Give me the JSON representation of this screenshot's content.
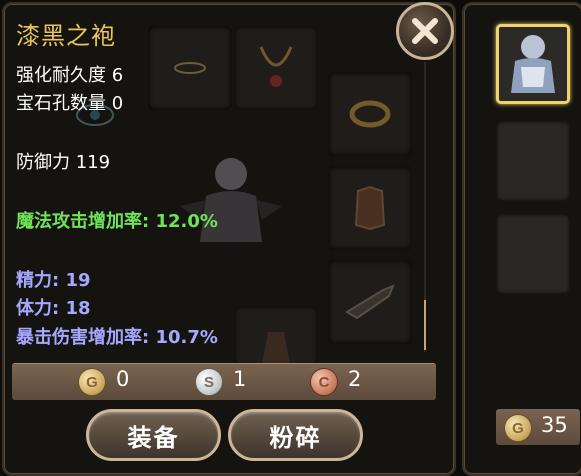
{
  "item": {
    "name": "漆黑之袍",
    "stats": [
      {
        "text": "强化耐久度 6",
        "color": "white"
      },
      {
        "text": "宝石孔数量 0",
        "color": "white"
      },
      {
        "text": "防御力 119",
        "color": "white"
      },
      {
        "text": "魔法攻击增加率: 12.0%",
        "color": "green"
      },
      {
        "text": "精力: 19",
        "color": "blue"
      },
      {
        "text": "体力: 18",
        "color": "blue"
      },
      {
        "text": "暴击伤害增加率: 10.7%",
        "color": "blue"
      }
    ]
  },
  "currency": {
    "gold": {
      "symbol": "G",
      "count": "0"
    },
    "silver": {
      "symbol": "S",
      "count": "1"
    },
    "copper": {
      "symbol": "C",
      "count": "2"
    }
  },
  "buttons": {
    "equip": "装备",
    "shatter": "粉碎"
  },
  "side": {
    "gold_symbol": "G",
    "gold_count": "35"
  },
  "colors": {
    "title": "#e8c65a",
    "green_stat": "#6fe35a",
    "blue_stat": "#a6a8ff",
    "selected_border": "#f1d36b"
  },
  "icons": [
    "close-icon",
    "necklace-icon",
    "ring-icon",
    "bracelet-icon",
    "armor-icon",
    "weapon-icon",
    "robe-icon"
  ]
}
